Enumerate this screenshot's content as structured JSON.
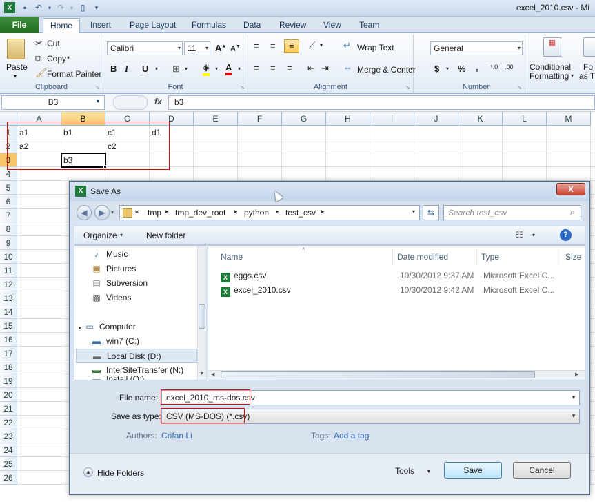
{
  "window": {
    "title": "excel_2010.csv - Mi"
  },
  "tabs": [
    "File",
    "Home",
    "Insert",
    "Page Layout",
    "Formulas",
    "Data",
    "Review",
    "View",
    "Team"
  ],
  "ribbon": {
    "clipboard": {
      "paste": "Paste",
      "cut": "Cut",
      "copy": "Copy",
      "format_painter": "Format Painter",
      "label": "Clipboard"
    },
    "font": {
      "name": "Calibri",
      "size": "11",
      "label": "Font"
    },
    "alignment": {
      "wrap": "Wrap Text",
      "merge": "Merge & Center",
      "label": "Alignment"
    },
    "number": {
      "format": "General",
      "label": "Number"
    },
    "styles": {
      "conditional": "Conditional",
      "formatting": "Formatting",
      "fo": "Fo",
      "as_t": "as T"
    }
  },
  "formula_bar": {
    "name_box": "B3",
    "fx": "fx",
    "content": "b3"
  },
  "columns": [
    "A",
    "B",
    "C",
    "D",
    "E",
    "F",
    "G",
    "H",
    "I",
    "J",
    "K",
    "L",
    "M"
  ],
  "rows": [
    "1",
    "2",
    "3",
    "4",
    "5",
    "6",
    "7",
    "8",
    "9",
    "10",
    "11",
    "12",
    "13",
    "14",
    "15",
    "16",
    "17",
    "18",
    "19",
    "20",
    "21",
    "22",
    "23",
    "24",
    "25",
    "26"
  ],
  "cells": {
    "a1": "a1",
    "b1": "b1",
    "c1": "c1",
    "d1": "d1",
    "a2": "a2",
    "c2": "c2",
    "b3": "b3"
  },
  "dialog": {
    "title": "Save As",
    "close": "X",
    "breadcrumb": [
      "«",
      "tmp",
      "tmp_dev_root",
      "python",
      "test_csv"
    ],
    "search_placeholder": "Search test_csv",
    "organize": "Organize",
    "new_folder": "New folder",
    "nav": {
      "music": "Music",
      "pictures": "Pictures",
      "subversion": "Subversion",
      "videos": "Videos",
      "computer": "Computer",
      "win7": "win7 (C:)",
      "local_disk": "Local Disk (D:)",
      "intersite": "InterSiteTransfer (N:)",
      "install": "Install (O:)"
    },
    "columns": {
      "name": "Name",
      "date": "Date modified",
      "type": "Type",
      "size": "Size"
    },
    "files": [
      {
        "name": "eggs.csv",
        "date": "10/30/2012 9:37 AM",
        "type": "Microsoft Excel C..."
      },
      {
        "name": "excel_2010.csv",
        "date": "10/30/2012 9:42 AM",
        "type": "Microsoft Excel C..."
      }
    ],
    "file_name_label": "File name:",
    "file_name": "excel_2010_ms-dos.csv",
    "save_type_label": "Save as type:",
    "save_type": "CSV (MS-DOS) (*.csv)",
    "authors_label": "Authors:",
    "authors": "Crifan Li",
    "tags_label": "Tags:",
    "tags": "Add a tag",
    "hide_folders": "Hide Folders",
    "tools": "Tools",
    "save": "Save",
    "cancel": "Cancel"
  },
  "colors": {
    "highlight_red": "#e00000",
    "file_tab": "#2a7a28",
    "selected_header": "#f7c66a"
  }
}
